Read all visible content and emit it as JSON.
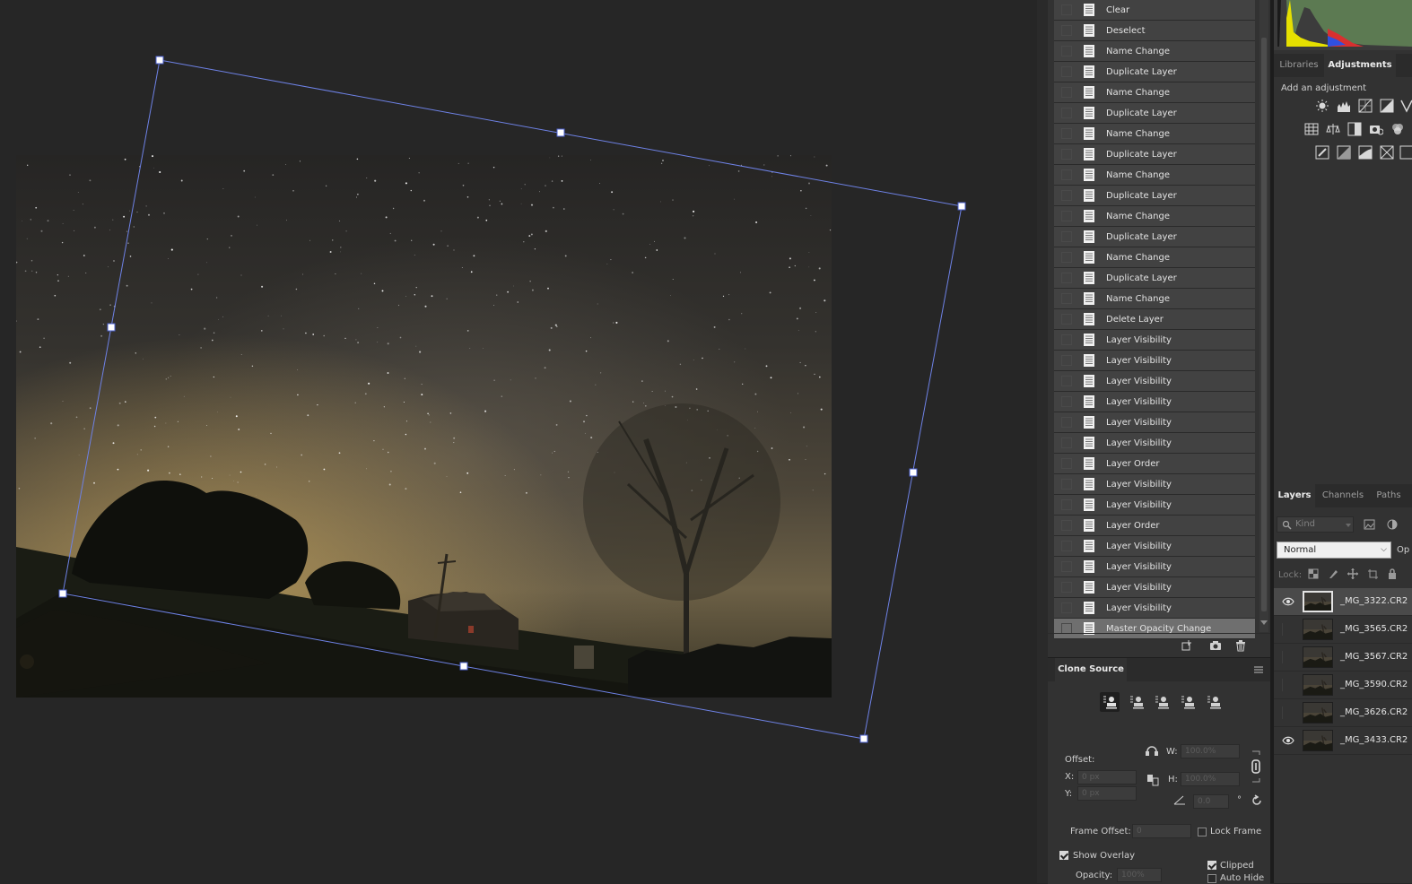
{
  "history": {
    "items": [
      {
        "label": "Clear"
      },
      {
        "label": "Deselect"
      },
      {
        "label": "Name Change"
      },
      {
        "label": "Duplicate Layer"
      },
      {
        "label": "Name Change"
      },
      {
        "label": "Duplicate Layer"
      },
      {
        "label": "Name Change"
      },
      {
        "label": "Duplicate Layer"
      },
      {
        "label": "Name Change"
      },
      {
        "label": "Duplicate Layer"
      },
      {
        "label": "Name Change"
      },
      {
        "label": "Duplicate Layer"
      },
      {
        "label": "Name Change"
      },
      {
        "label": "Duplicate Layer"
      },
      {
        "label": "Name Change"
      },
      {
        "label": "Delete Layer"
      },
      {
        "label": "Layer Visibility"
      },
      {
        "label": "Layer Visibility"
      },
      {
        "label": "Layer Visibility"
      },
      {
        "label": "Layer Visibility"
      },
      {
        "label": "Layer Visibility"
      },
      {
        "label": "Layer Visibility"
      },
      {
        "label": "Layer Order"
      },
      {
        "label": "Layer Visibility"
      },
      {
        "label": "Layer Visibility"
      },
      {
        "label": "Layer Order"
      },
      {
        "label": "Layer Visibility"
      },
      {
        "label": "Layer Visibility"
      },
      {
        "label": "Layer Visibility"
      },
      {
        "label": "Layer Visibility"
      },
      {
        "label": "Master Opacity Change",
        "active": true
      }
    ]
  },
  "clone_source": {
    "tab": "Clone Source",
    "offset_label": "Offset:",
    "x_label": "X:",
    "x_value": "0 px",
    "y_label": "Y:",
    "y_value": "0 px",
    "w_label": "W:",
    "w_value": "100.0%",
    "h_label": "H:",
    "h_value": "100.0%",
    "angle_value": "0.0",
    "angle_unit": "°",
    "frame_offset_label": "Frame Offset:",
    "frame_offset_value": "0",
    "lock_frame_label": "Lock Frame",
    "show_overlay_label": "Show Overlay",
    "opacity_label": "Opacity:",
    "opacity_value": "100%",
    "clipped_label": "Clipped",
    "auto_hide_label": "Auto Hide"
  },
  "adjustments": {
    "tabs": [
      "Libraries",
      "Adjustments"
    ],
    "caption": "Add an adjustment"
  },
  "layers": {
    "tabs": [
      "Layers",
      "Channels",
      "Paths"
    ],
    "filter_placeholder": "Kind",
    "blend_mode": "Normal",
    "opacity_label": "Op",
    "lock_label": "Lock:",
    "items": [
      {
        "name": "_MG_3322.CR2",
        "visible": true,
        "selected": true
      },
      {
        "name": "_MG_3565.CR2",
        "visible": false
      },
      {
        "name": "_MG_3567.CR2",
        "visible": false
      },
      {
        "name": "_MG_3590.CR2",
        "visible": false
      },
      {
        "name": "_MG_3626.CR2",
        "visible": false
      },
      {
        "name": "_MG_3433.CR2",
        "visible": true
      }
    ]
  },
  "colors": {
    "canvas_bg": "#262626",
    "panel_bg": "#323232",
    "transform_line": "#6e82e6"
  }
}
